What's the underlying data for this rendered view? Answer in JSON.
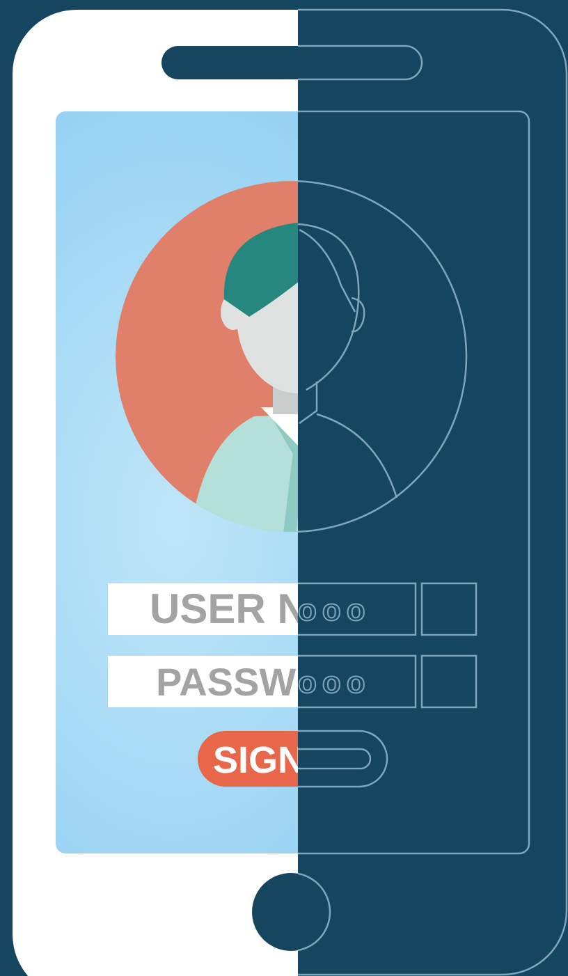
{
  "login_form": {
    "username_label": "USER NA",
    "password_label": "PASSW",
    "sign_in_label": "SIGN",
    "username_dots": "ooo",
    "password_dots": "ooo"
  },
  "colors": {
    "background": "#16455f",
    "phone_body": "#ffffff",
    "screen_light": "#bfe6f8",
    "screen_dark": "#86c9f1",
    "avatar_circle": "#e0806a",
    "hair": "#26877f",
    "face": "#dfe2e1",
    "shirt": "#b5dfd9",
    "button": "#e8664a",
    "outline": "#7fa6bb"
  },
  "icons": {
    "user_avatar": "user-avatar-icon",
    "home_button": "home-button-icon",
    "speaker": "speaker-slot-icon"
  }
}
